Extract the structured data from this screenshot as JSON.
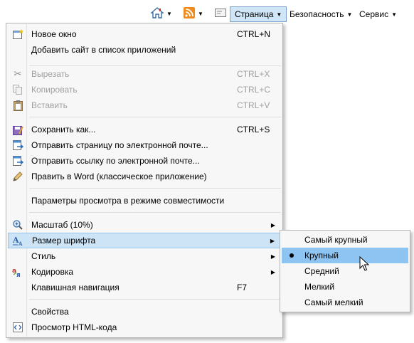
{
  "toolbar": {
    "icons": [
      "home-icon",
      "rss-feed-icon",
      "mail-icon"
    ],
    "menus": [
      {
        "label": "Страница"
      },
      {
        "label": "Безопасность"
      },
      {
        "label": "Сервис"
      }
    ]
  },
  "page_menu": {
    "items": [
      {
        "label": "Новое окно",
        "shortcut": "CTRL+N",
        "icon": "new-window-icon"
      },
      {
        "label": "Добавить сайт в список приложений"
      },
      {
        "label": "Вырезать",
        "shortcut": "CTRL+X",
        "icon": "scissors-icon",
        "disabled": true
      },
      {
        "label": "Копировать",
        "shortcut": "CTRL+C",
        "icon": "copy-icon",
        "disabled": true
      },
      {
        "label": "Вставить",
        "shortcut": "CTRL+V",
        "icon": "paste-icon",
        "disabled": true
      },
      {
        "label": "Сохранить как...",
        "shortcut": "CTRL+S",
        "icon": "save-as-icon"
      },
      {
        "label": "Отправить страницу по электронной почте...",
        "icon": "email-page-icon"
      },
      {
        "label": "Отправить ссылку по электронной почте...",
        "icon": "email-link-icon"
      },
      {
        "label": "Править в Word (классическое приложение)",
        "icon": "edit-pencil-icon"
      },
      {
        "label": "Параметры просмотра в режиме совместимости"
      },
      {
        "label": "Масштаб (10%)",
        "icon": "zoom-icon",
        "submenu": true
      },
      {
        "label": "Размер шрифта",
        "icon": "font-size-icon",
        "submenu": true
      },
      {
        "label": "Стиль",
        "submenu": true
      },
      {
        "label": "Кодировка",
        "icon": "encoding-icon",
        "submenu": true
      },
      {
        "label": "Клавишная навигация",
        "shortcut": "F7"
      },
      {
        "label": "Свойства"
      },
      {
        "label": "Просмотр HTML-кода",
        "icon": "html-source-icon"
      }
    ]
  },
  "font_size_submenu": {
    "items": [
      {
        "label": "Самый крупный"
      },
      {
        "label": "Крупный",
        "selected": true
      },
      {
        "label": "Средний"
      },
      {
        "label": "Мелкий"
      },
      {
        "label": "Самый мелкий"
      }
    ]
  }
}
